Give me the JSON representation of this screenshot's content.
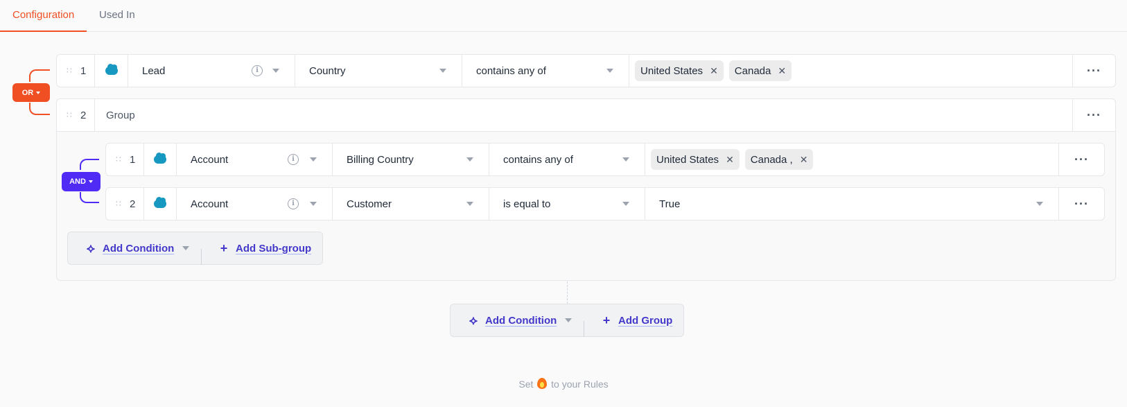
{
  "tabs": [
    {
      "label": "Configuration",
      "active": true
    },
    {
      "label": "Used In",
      "active": false
    }
  ],
  "colors": {
    "or_accent": "#f04e23",
    "and_accent": "#4f2bf5",
    "link": "#4338ca",
    "salesforce": "#1798c1"
  },
  "root": {
    "operator": "OR",
    "rules": [
      {
        "index": "1",
        "icon": "salesforce-cloud-icon",
        "object": "Lead",
        "field": "Country",
        "operator": "contains any of",
        "values": [
          "United States",
          "Canada"
        ]
      }
    ],
    "group": {
      "index": "2",
      "label": "Group",
      "operator": "AND",
      "rules": [
        {
          "index": "1",
          "icon": "salesforce-cloud-icon",
          "object": "Account",
          "field": "Billing Country",
          "operator": "contains any of",
          "values": [
            "United States",
            "Canada ,"
          ]
        },
        {
          "index": "2",
          "icon": "salesforce-cloud-icon",
          "object": "Account",
          "field": "Customer",
          "operator": "is equal to",
          "value": "True"
        }
      ],
      "actions": {
        "add_condition": "Add Condition",
        "add_subgroup": "Add Sub-group"
      }
    },
    "actions": {
      "add_condition": "Add Condition",
      "add_group": "Add Group"
    }
  },
  "footer": {
    "prefix": "Set",
    "suffix": "to your Rules",
    "emoji_icon": "fire-icon"
  }
}
